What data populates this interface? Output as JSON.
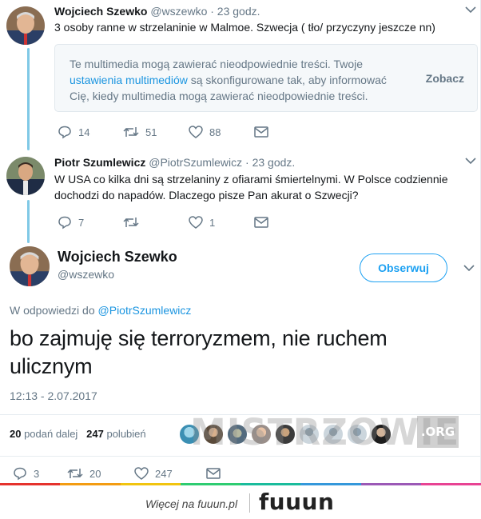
{
  "tweet1": {
    "name": "Wojciech Szewko",
    "handle": "@wszewko",
    "time": "· 23 godz.",
    "text": "3 osoby ranne w strzelaninie w Malmoe. Szwecja ( tło/ przyczyny jeszcze nn)",
    "media_warning": {
      "line1": "Te multimedia mogą zawierać nieodpowiednie treści. Twoje",
      "link": "ustawienia multimediów",
      "line2_rest": " są skonfigurowane tak, aby informować",
      "line3": "Cię, kiedy multimedia mogą zawierać nieodpowiednie treści.",
      "show_label": "Zobacz"
    },
    "replies": "14",
    "retweets": "51",
    "likes": "88"
  },
  "tweet2": {
    "name": "Piotr Szumlewicz",
    "handle": "@PiotrSzumlewicz",
    "time": "· 23 godz.",
    "text": "W USA co kilka dni są strzelaniny z ofiarami śmiertelnymi. W Polsce codziennie dochodzi do napadów. Dlaczego pisze Pan akurat o Szwecji?",
    "replies": "7",
    "retweets": "",
    "likes": "1"
  },
  "main_tweet": {
    "name": "Wojciech Szewko",
    "handle": "@wszewko",
    "follow_label": "Obserwuj",
    "reply_prefix": "W odpowiedzi do ",
    "reply_handle": "@PiotrSzumlewicz",
    "text": "bo zajmuję się terroryzmem, nie ruchem ulicznym",
    "timestamp": "12:13 - 2.07.2017",
    "retweet_count": "20",
    "retweet_label": " podań dalej",
    "like_count": "247",
    "like_label": " polubień",
    "actions": {
      "replies": "3",
      "retweets": "20",
      "likes": "247"
    }
  },
  "watermark": {
    "text": "MISTRZOWIE",
    "suffix": ".ORG"
  },
  "footer": {
    "more_text": "Więcej na fuuun.pl",
    "logo": "fuuun"
  },
  "colors": {
    "link": "#1b95e0",
    "accent": "#1da1f2",
    "thread_line": "#80c9e6",
    "muted": "#657786",
    "colorbar": [
      "#e5322d",
      "#f39c12",
      "#f1c40f",
      "#2ecc71",
      "#1abc9c",
      "#3498db",
      "#9b59b6",
      "#e84393"
    ]
  }
}
